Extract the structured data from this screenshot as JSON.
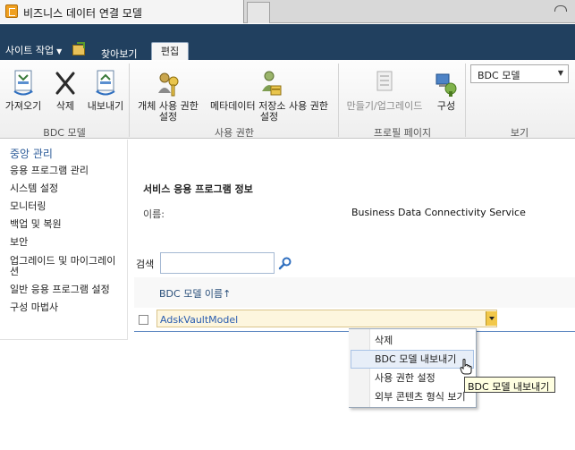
{
  "browser": {
    "tab_title": "비즈니스 데이터 연결 모델"
  },
  "ribbon_header": {
    "site_actions": "사이트 작업",
    "tab_browse": "찾아보기",
    "tab_edit": "편집"
  },
  "ribbon": {
    "import": "가져오기",
    "delete": "삭제",
    "export": "내보내기",
    "bdc_model_group": "BDC 모델",
    "set_object_permissions_1": "개체 사용 권한",
    "set_object_permissions_2": "설정",
    "set_metadata_store_permissions_1": "메타데이터 저장소 사용 권한",
    "set_metadata_store_permissions_2": "설정",
    "permissions_group": "사용 권한",
    "create_upgrade": "만들기/업그레이드",
    "configure": "구성",
    "profile_pages_group": "프로필 페이지",
    "view_select": "BDC 모델",
    "view_group": "보기"
  },
  "left_nav": {
    "heading": "중앙 관리",
    "items": [
      "응용 프로그램 관리",
      "시스템 설정",
      "모니터링",
      "백업 및 복원",
      "보안",
      "업그레이드 및 마이그레이",
      "션",
      "일반 응용 프로그램 설정",
      "구성 마법사"
    ]
  },
  "main": {
    "section_title": "서비스 응용 프로그램 정보",
    "name_label": "이름:",
    "name_value": "Business Data Connectivity Service",
    "search_label": "검색",
    "search_value": "",
    "column_header": "BDC 모델 이름↑",
    "rows": [
      {
        "name": "AdskVaultModel"
      }
    ]
  },
  "context_menu": {
    "items": [
      "삭제",
      "BDC 모델 내보내기",
      "사용 권한 설정",
      "외부 콘텐츠 형식 보기"
    ],
    "tooltip": "BDC 모델 내보내기"
  }
}
